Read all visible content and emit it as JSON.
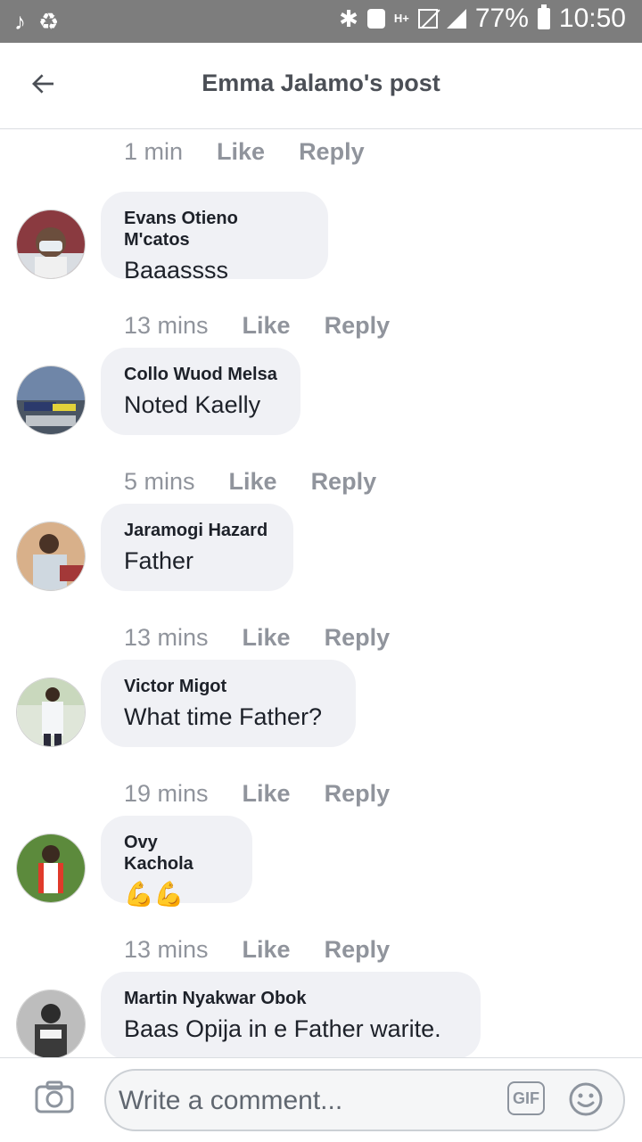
{
  "status_bar": {
    "battery": "77%",
    "time": "10:50",
    "network": "H+"
  },
  "header": {
    "title": "Emma Jalamo's post"
  },
  "actions": {
    "like": "Like",
    "reply": "Reply"
  },
  "top_meta": {
    "time": "1 min"
  },
  "comments": [
    {
      "author": "Evans Otieno M'catos",
      "text": "Baaassss",
      "time": "13 mins"
    },
    {
      "author": "Collo Wuod Melsa",
      "text": "Noted Kaelly",
      "time": "5 mins"
    },
    {
      "author": "Jaramogi Hazard",
      "text": "Father",
      "time": "13 mins"
    },
    {
      "author": "Victor Migot",
      "text": "What time Father?",
      "time": "19 mins"
    },
    {
      "author": "Ovy Kachola",
      "text": "💪💪",
      "time": "13 mins"
    },
    {
      "author": "Martin Nyakwar Obok",
      "text": "Baas Opija in e Father warite."
    }
  ],
  "composer": {
    "placeholder": "Write a comment...",
    "gif_label": "GIF"
  },
  "colors": {
    "status_bar_bg": "#7d7d7d",
    "bubble_bg": "#f0f1f5",
    "meta_text": "#90949c",
    "title_text": "#4b4f56"
  }
}
